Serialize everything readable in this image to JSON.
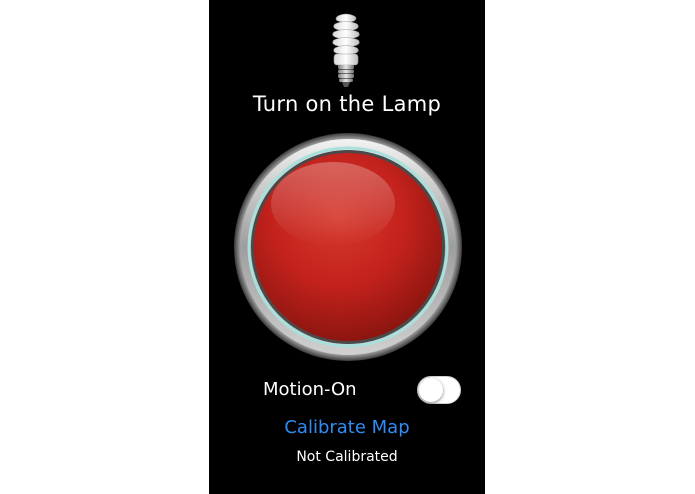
{
  "lamp": {
    "icon": "lightbulb-icon",
    "title": "Turn on the Lamp"
  },
  "power_button": {
    "icon": "big-red-button",
    "color": "#c3221c",
    "ring_color": "#a9e0dc"
  },
  "motion": {
    "label": "Motion-On",
    "enabled": false
  },
  "calibrate": {
    "label": "Calibrate Map",
    "color": "#2f8cf3",
    "status": "Not Calibrated"
  }
}
